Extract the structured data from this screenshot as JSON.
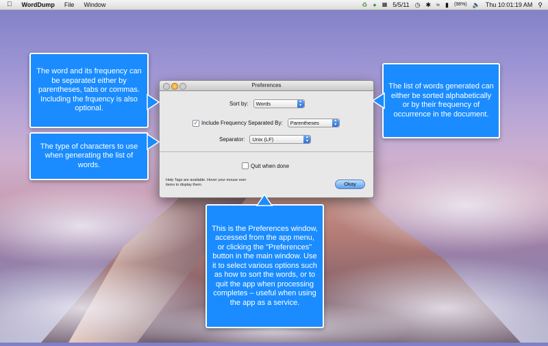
{
  "menubar": {
    "app_name": "WordDump",
    "menus": [
      "File",
      "Window"
    ],
    "date": "5/5/11",
    "battery": "(98%)",
    "clock": "Thu 10:01:19 AM"
  },
  "prefs": {
    "title": "Preferences",
    "sort_by_label": "Sort by:",
    "sort_by_value": "Words",
    "include_freq_label": "Include Frequency Separated By:",
    "include_freq_checked": true,
    "include_freq_value": "Parentheses",
    "separator_label": "Separator:",
    "separator_value": "Unix (LF)",
    "quit_label": "Quit when done",
    "quit_checked": false,
    "help_text": "Help Tags are available. Hover your mouse over items to display them.",
    "okay_label": "Okay"
  },
  "callouts": {
    "frequency": "The word and its frequency can be separated either by parentheses, tabs or commas. Including the frquency is also optional.",
    "separator": "The type of characters to use when generating the list of words.",
    "sort": "The list of words generated can either be sorted alphabetically or by their frequency of occurrence in the document.",
    "window": "This is the Preferences window, accessed from the app menu, or clicking the \"Preferences\" button in the main window. Use it to select various options such as how to sort the words, or to quit the app when processing completes – useful when using the app as a service."
  },
  "colors": {
    "callout_blue": "#1a8cff",
    "okay_button": "#5c9ff0"
  }
}
